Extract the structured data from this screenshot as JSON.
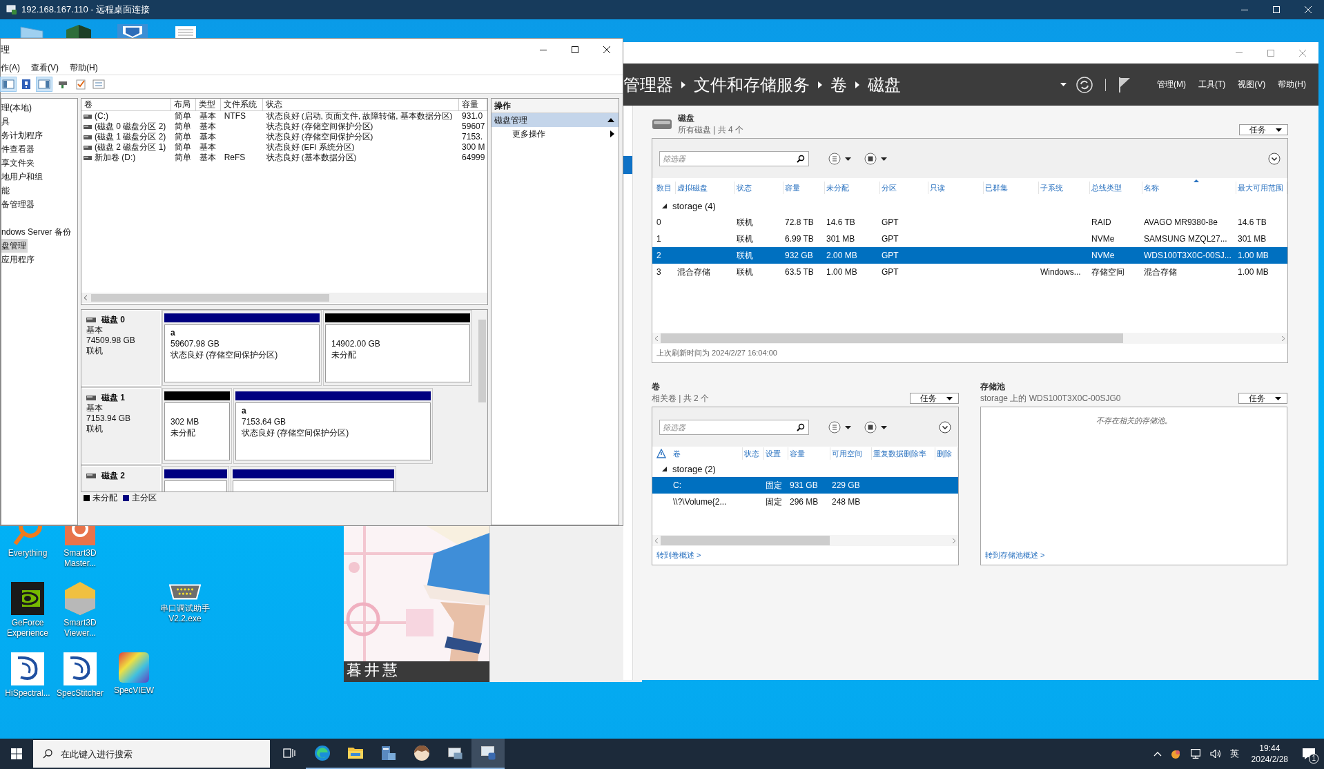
{
  "rdp_window": {
    "title": "192.168.167.110 - 远程桌面连接"
  },
  "desktop_icons": [
    {
      "kind": "everything",
      "label": "Everything"
    },
    {
      "kind": "smart3d-master",
      "label": "Smart3D Master..."
    },
    {
      "kind": "geforce",
      "label": "GeForce Experience"
    },
    {
      "kind": "smart3d-viewer",
      "label": "Smart3D Viewer..."
    },
    {
      "kind": "serial",
      "label": "串口调试助手 V2.2.exe"
    },
    {
      "kind": "radi",
      "label": "HiSpectral..."
    },
    {
      "kind": "radi",
      "label": "SpecStitcher"
    },
    {
      "kind": "specview",
      "label": "SpecVIEW"
    }
  ],
  "wallpaper_widget": {
    "kind": "picture",
    "caption": "暮井慧"
  },
  "disk_management": {
    "title": "理",
    "menu": [
      "作(A)",
      "查看(V)",
      "帮助(H)"
    ],
    "tree": [
      {
        "label": "理(本地)",
        "selected": false
      },
      {
        "label": "具",
        "selected": false
      },
      {
        "label": "务计划程序",
        "selected": false
      },
      {
        "label": "件查看器",
        "selected": false
      },
      {
        "label": "享文件夹",
        "selected": false
      },
      {
        "label": "地用户和组",
        "selected": false
      },
      {
        "label": "能",
        "selected": false
      },
      {
        "label": "备管理器",
        "selected": false
      },
      {
        "label": "ndows Server 备份",
        "selected": false
      },
      {
        "label": "盘管理",
        "selected": true
      },
      {
        "label": "应用程序",
        "selected": false
      }
    ],
    "volume_table": {
      "columns": [
        "卷",
        "布局",
        "类型",
        "文件系统",
        "状态",
        "容量"
      ],
      "rows": [
        {
          "volume": "(C:)",
          "layout": "简单",
          "type": "基本",
          "fs": "NTFS",
          "status": "状态良好 (启动, 页面文件, 故障转储, 基本数据分区)",
          "capacity": "931.0"
        },
        {
          "volume": "(磁盘 0 磁盘分区 2)",
          "layout": "简单",
          "type": "基本",
          "status": "状态良好 (存储空间保护分区)",
          "capacity": "59607"
        },
        {
          "volume": "(磁盘 1 磁盘分区 2)",
          "layout": "简单",
          "type": "基本",
          "status": "状态良好 (存储空间保护分区)",
          "capacity": "7153."
        },
        {
          "volume": "(磁盘 2 磁盘分区 1)",
          "layout": "简单",
          "type": "基本",
          "status": "状态良好 (EFI 系统分区)",
          "capacity": "300 M"
        },
        {
          "volume": "新加卷 (D:)",
          "layout": "简单",
          "type": "基本",
          "fs": "ReFS",
          "status": "状态良好 (基本数据分区)",
          "capacity": "64999"
        }
      ]
    },
    "disks": [
      {
        "name": "磁盘 0",
        "type": "基本",
        "size": "74509.98 GB",
        "status": "联机",
        "partitions": [
          {
            "kind": "primary",
            "label": "a",
            "size": "59607.98 GB",
            "status": "状态良好 (存储空间保护分区)"
          },
          {
            "kind": "unallocated",
            "size": "14902.00 GB",
            "status": "未分配"
          }
        ]
      },
      {
        "name": "磁盘 1",
        "type": "基本",
        "size": "7153.94 GB",
        "status": "联机",
        "partitions": [
          {
            "kind": "unallocated",
            "size": "302 MB",
            "status": "未分配"
          },
          {
            "kind": "primary",
            "label": "a",
            "size": "7153.64 GB",
            "status": "状态良好 (存储空间保护分区)"
          }
        ]
      },
      {
        "name": "磁盘 2",
        "partitions": [
          {
            "kind": "primary"
          },
          {
            "kind": "primary"
          }
        ]
      }
    ],
    "legend": [
      {
        "kind": "unallocated",
        "label": "未分配"
      },
      {
        "kind": "primary",
        "label": "主分区"
      }
    ],
    "actions": {
      "header": "操作",
      "items": [
        {
          "kind": "section",
          "label": "磁盘管理",
          "selected": true
        },
        {
          "kind": "submenu",
          "label": "更多操作",
          "selected": false
        }
      ]
    }
  },
  "server_manager": {
    "breadcrumb": [
      "管理器",
      "文件和存储服务",
      "卷",
      "磁盘"
    ],
    "menu": [
      "管理(M)",
      "工具(T)",
      "视图(V)",
      "帮助(H)"
    ],
    "disks_panel": {
      "title": "磁盘",
      "subtitle": "所有磁盘 | 共 4 个",
      "tasks": "任务",
      "filter_placeholder": "筛选器",
      "columns": [
        "数目",
        "虚拟磁盘",
        "状态",
        "容量",
        "未分配",
        "分区",
        "只读",
        "已群集",
        "子系统",
        "总线类型",
        "名称",
        "最大可用范围"
      ],
      "group": "storage (4)",
      "rows": [
        {
          "selected": false,
          "cells": [
            "0",
            null,
            "联机",
            "72.8 TB",
            "14.6 TB",
            "GPT",
            null,
            null,
            null,
            "RAID",
            "AVAGO MR9380-8e",
            "14.6 TB"
          ]
        },
        {
          "selected": false,
          "cells": [
            "1",
            null,
            "联机",
            "6.99 TB",
            "301 MB",
            "GPT",
            null,
            null,
            null,
            "NVMe",
            "SAMSUNG MZQL27...",
            "301 MB"
          ]
        },
        {
          "selected": true,
          "cells": [
            "2",
            null,
            "联机",
            "932 GB",
            "2.00 MB",
            "GPT",
            null,
            null,
            null,
            "NVMe",
            "WDS100T3X0C-00SJ...",
            "1.00 MB"
          ]
        },
        {
          "selected": false,
          "cells": [
            "3",
            "混合存储",
            "联机",
            "63.5 TB",
            "1.00 MB",
            "GPT",
            null,
            null,
            "Windows...",
            "存储空间",
            "混合存储",
            "1.00 MB"
          ]
        }
      ],
      "refresh": "上次刷新时间为 2024/2/27 16:04:00"
    },
    "volumes_panel": {
      "title": "卷",
      "subtitle": "相关卷 | 共 2 个",
      "tasks": "任务",
      "filter_placeholder": "筛选器",
      "columns": [
        "卷",
        "状态",
        "设置",
        "容量",
        "可用空间",
        "重复数据删除率",
        "删除"
      ],
      "group": "storage (2)",
      "rows": [
        {
          "selected": true,
          "volume": "C:",
          "setting": "固定",
          "capacity": "931 GB",
          "free": "229 GB"
        },
        {
          "selected": false,
          "volume": "\\\\?\\Volume{2...",
          "setting": "固定",
          "capacity": "296 MB",
          "free": "248 MB"
        }
      ],
      "link": "转到卷概述 >"
    },
    "pools_panel": {
      "title": "存储池",
      "subtitle": "storage 上的 WDS100T3X0C-00SJG0",
      "tasks": "任务",
      "message": "不存在相关的存储池。",
      "link": "转到存储池概述 >"
    }
  },
  "taskbar": {
    "search_placeholder": "在此键入进行搜索",
    "apps": [
      {
        "kind": "task-view",
        "running": false,
        "selected": false
      },
      {
        "kind": "edge",
        "running": true,
        "selected": false
      },
      {
        "kind": "explorer",
        "running": true,
        "selected": false
      },
      {
        "kind": "server-manager",
        "running": true,
        "selected": false
      },
      {
        "kind": "avatar",
        "running": true,
        "selected": false
      },
      {
        "kind": "remote-viewer",
        "running": true,
        "selected": false
      },
      {
        "kind": "remote-desktop",
        "running": true,
        "selected": true
      }
    ],
    "ime": "英",
    "time": "19:44",
    "date": "2024/2/28",
    "notification_count": "1"
  }
}
